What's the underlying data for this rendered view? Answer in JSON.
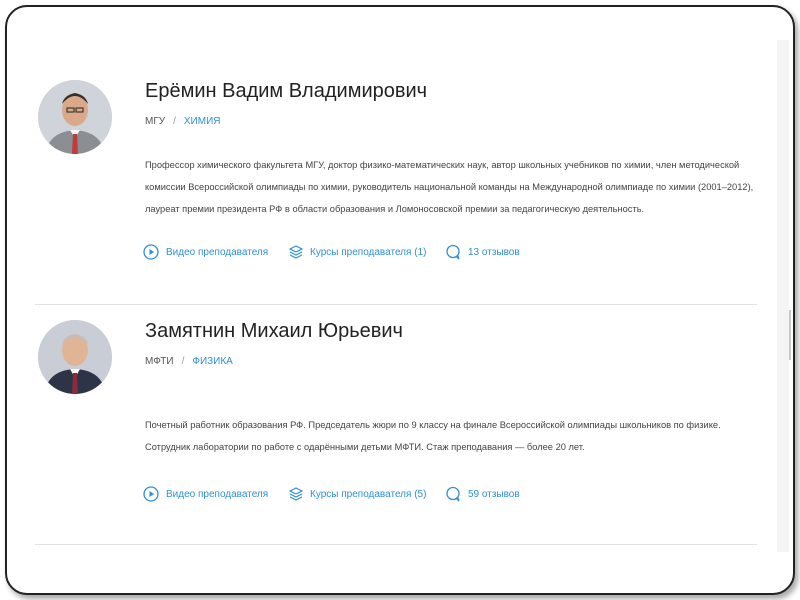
{
  "teachers": [
    {
      "name": "Ерёмин Вадим Владимирович",
      "university": "МГУ",
      "separator": "/",
      "subject": "ХИМИЯ",
      "bio": "Профессор химического факультета МГУ, доктор физико-математических наук, автор школьных учебников по химии, член методической комиссии Всероссийской олимпиады по химии, руководитель национальной команды на Международной олимпиаде по химии (2001–2012), лауреат премии президента РФ в области образования и Ломоносовской премии за педагогическую деятельность.",
      "video_label": "Видео преподавателя",
      "courses_label": "Курсы преподавателя (1)",
      "reviews_label": "13 отзывов"
    },
    {
      "name": "Замятнин Михаил Юрьевич",
      "university": "МФТИ",
      "separator": "/",
      "subject": "ФИЗИКА",
      "bio": "Почетный работник образования РФ. Председатель жюри по 9 классу на финале Всероссийской олимпиады школьников по физике. Сотрудник лаборатории по работе с одарёнными детьми МФТИ. Стаж преподавания — более 20 лет.",
      "video_label": "Видео преподавателя",
      "courses_label": "Курсы преподавателя (5)",
      "reviews_label": "59 отзывов"
    }
  ],
  "colors": {
    "accent": "#2f8fd6",
    "name_text": "#222222",
    "body_text": "#444444",
    "divider": "#e2e2e2"
  },
  "icons": {
    "video": "play-circle-icon",
    "courses": "layers-icon",
    "reviews": "speech-bubble-icon"
  }
}
